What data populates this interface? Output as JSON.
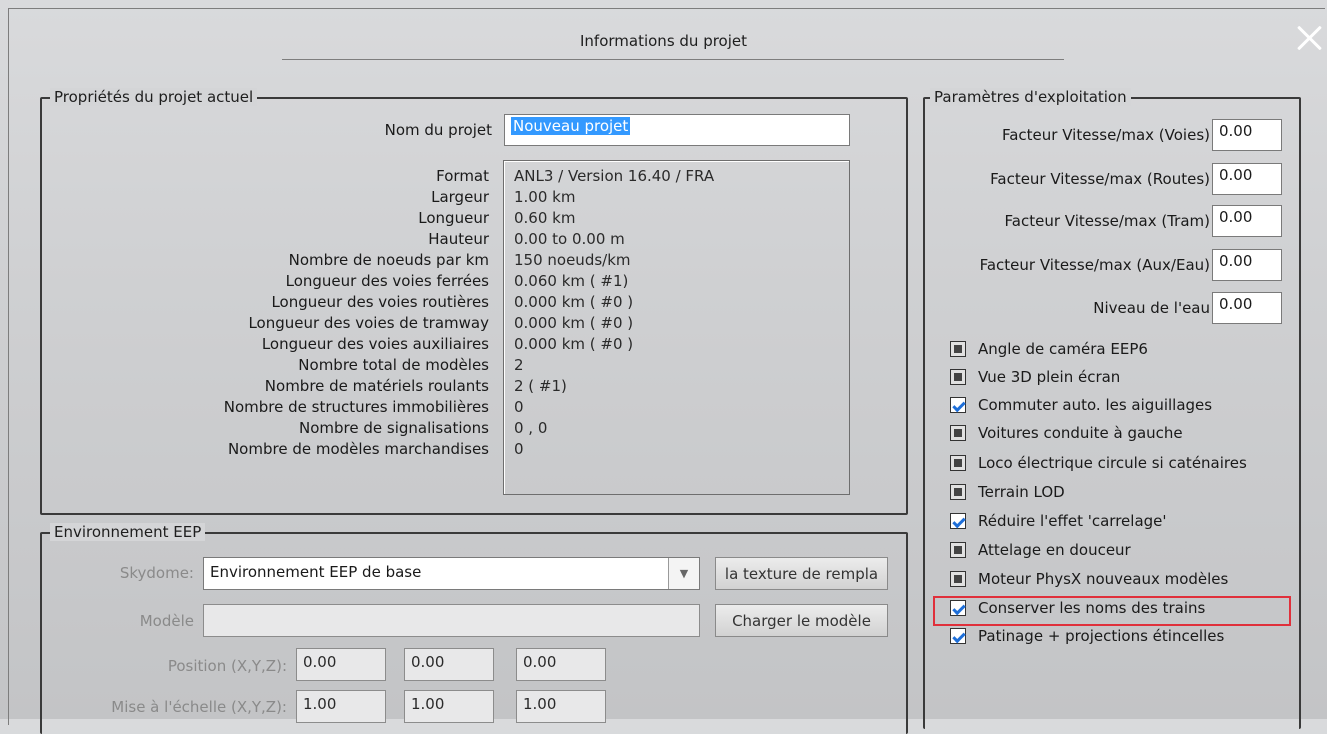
{
  "window": {
    "title": "Informations du projet"
  },
  "project_props": {
    "group_title": "Propriétés du projet actuel",
    "name_label": "Nom du projet",
    "name_value": "Nouveau projet",
    "rows": [
      {
        "label": "Format",
        "value": "ANL3 / Version 16.40 / FRA"
      },
      {
        "label": "Largeur",
        "value": "1.00 km"
      },
      {
        "label": "Longueur",
        "value": "0.60 km"
      },
      {
        "label": "Hauteur",
        "value": "0.00 to 0.00 m"
      },
      {
        "label": "Nombre de noeuds par km",
        "value": "150  noeuds/km"
      },
      {
        "label": "Longueur des voies ferrées",
        "value": "0.060 km ( #1)"
      },
      {
        "label": "Longueur des voies routières",
        "value": "0.000 km ( #0 )"
      },
      {
        "label": "Longueur des voies de tramway",
        "value": "0.000 km ( #0 )"
      },
      {
        "label": "Longueur des voies auxiliaires",
        "value": "0.000 km ( #0 )"
      },
      {
        "label": "Nombre total de modèles",
        "value": "2"
      },
      {
        "label": "Nombre de matériels roulants",
        "value": "2 ( #1)"
      },
      {
        "label": "Nombre de structures immobilières",
        "value": "0"
      },
      {
        "label": "Nombre de signalisations",
        "value": "0 , 0"
      },
      {
        "label": "Nombre de modèles marchandises",
        "value": "0"
      }
    ]
  },
  "environment": {
    "group_title": "Environnement EEP",
    "skydome_label": "Skydome:",
    "skydome_value": "Environnement EEP de base",
    "texture_button": "la texture de rempla",
    "model_label": "Modèle",
    "load_model_button": "Charger le modèle",
    "position_label": "Position (X,Y,Z):",
    "position": [
      "0.00",
      "0.00",
      "0.00"
    ],
    "scale_label": "Mise à l'échelle (X,Y,Z):",
    "scale": [
      "1.00",
      "1.00",
      "1.00"
    ]
  },
  "operation": {
    "group_title": "Paramètres d'exploitation",
    "fields": [
      {
        "label": "Facteur Vitesse/max (Voies)",
        "value": "0.00"
      },
      {
        "label": "Facteur Vitesse/max (Routes)",
        "value": "0.00"
      },
      {
        "label": "Facteur Vitesse/max (Tram)",
        "value": "0.00"
      },
      {
        "label": "Facteur Vitesse/max (Aux/Eau)",
        "value": "0.00"
      },
      {
        "label": "Niveau de l'eau",
        "value": "0.00"
      }
    ],
    "checkboxes": [
      {
        "label": "Angle de caméra EEP6",
        "checked": false
      },
      {
        "label": "Vue 3D plein écran",
        "checked": false
      },
      {
        "label": "Commuter auto. les aiguillages",
        "checked": true
      },
      {
        "label": "Voitures conduite à gauche",
        "checked": false
      },
      {
        "label": "Loco électrique circule si caténaires",
        "checked": false
      },
      {
        "label": "Terrain LOD",
        "checked": false
      },
      {
        "label": "Réduire l'effet 'carrelage'",
        "checked": true
      },
      {
        "label": "Attelage en douceur",
        "checked": false
      },
      {
        "label": "Moteur PhysX nouveaux modèles",
        "checked": false
      },
      {
        "label": "Conserver les noms des trains",
        "checked": true
      },
      {
        "label": "Patinage + projections étincelles",
        "checked": true
      }
    ]
  },
  "colors": {
    "highlight": "#e0303b",
    "selection": "#3399ff",
    "check": "#1e6fd9"
  }
}
